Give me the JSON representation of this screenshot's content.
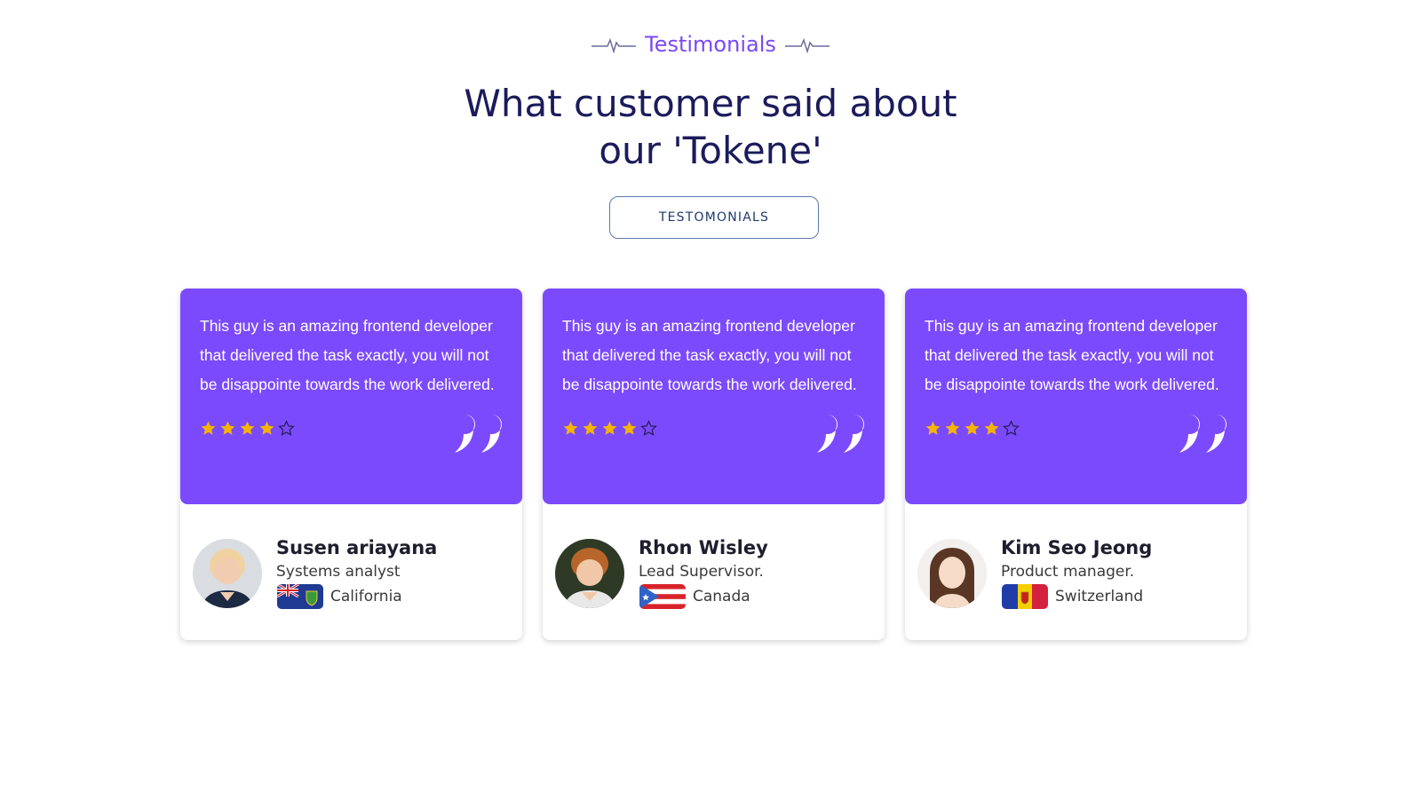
{
  "section": {
    "tag": "Testimonials",
    "headline_line1": "What customer said about",
    "headline_line2": "our 'Tokene'",
    "tab_button": "TESTOMONIALS"
  },
  "colors": {
    "brand_purple": "#7c4afd",
    "heading_navy": "#1b1b5c",
    "star_gold": "#f5b400"
  },
  "testimonials": [
    {
      "quote": "This guy is an amazing frontend developer that delivered the task exactly, you will not be disappointe towards the work delivered.",
      "rating": 4,
      "rating_max": 5,
      "name": "Susen ariayana",
      "role": "Systems analyst",
      "location": "California",
      "flag_icon": "pitcairn-islands-flag-icon",
      "avatar_icon": "avatar-photo-icon"
    },
    {
      "quote": "This guy is an amazing frontend developer that delivered the task exactly, you will not be disappointe towards the work delivered.",
      "rating": 4,
      "rating_max": 5,
      "name": "Rhon Wisley",
      "role": "Lead Supervisor.",
      "location": "Canada",
      "flag_icon": "puerto-rico-flag-icon",
      "avatar_icon": "avatar-photo-icon"
    },
    {
      "quote": "This guy is an amazing frontend developer that delivered the task exactly, you will not be disappointe towards the work delivered.",
      "rating": 4,
      "rating_max": 5,
      "name": "Kim Seo Jeong",
      "role": "Product manager.",
      "location": "Switzerland",
      "flag_icon": "andorra-flag-icon",
      "avatar_icon": "avatar-photo-icon"
    }
  ]
}
